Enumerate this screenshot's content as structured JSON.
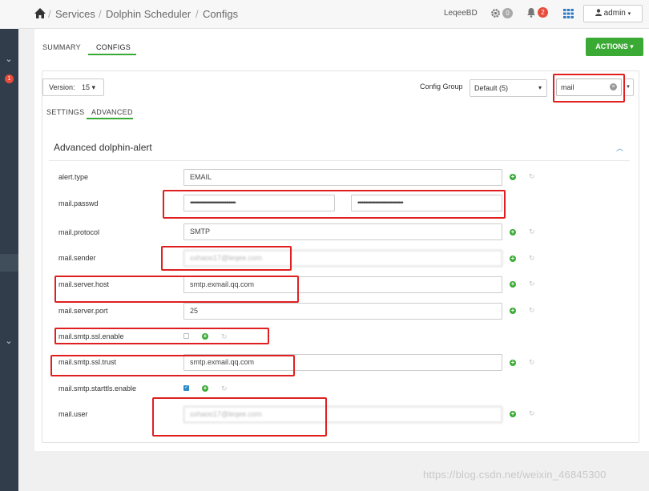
{
  "breadcrumb": {
    "items": [
      "Services",
      "Dolphin Scheduler",
      "Configs"
    ],
    "sep": "/"
  },
  "topbar": {
    "cluster_name": "LeqeeBD",
    "settings_badge": "0",
    "alerts_badge": "2",
    "user_label": "admin",
    "caret": "▾"
  },
  "sidebar": {
    "notification_badge": "1"
  },
  "page_tabs": {
    "summary": "SUMMARY",
    "configs": "CONFIGS"
  },
  "actions_button": "ACTIONS ▾",
  "version": {
    "label": "Version:",
    "value": "15 ▾"
  },
  "config_group": {
    "label": "Config Group",
    "selected": "Default (5)"
  },
  "filter": {
    "value": "mail"
  },
  "config_tabs": {
    "settings": "SETTINGS",
    "advanced": "ADVANCED"
  },
  "section": {
    "title": "Advanced dolphin-alert"
  },
  "properties": [
    {
      "label": "alert.type",
      "value": "EMAIL"
    },
    {
      "label": "mail.passwd",
      "value": "••••••••••••••••••••••••••••••••••",
      "confirm": "••••••••••••••••••••••••••••••••••"
    },
    {
      "label": "mail.protocol",
      "value": "SMTP"
    },
    {
      "label": "mail.sender",
      "value": "xxhaoo17@leqee.com"
    },
    {
      "label": "mail.server.host",
      "value": "smtp.exmail.qq.com"
    },
    {
      "label": "mail.server.port",
      "value": "25"
    },
    {
      "label": "mail.smtp.ssl.enable",
      "checked": false
    },
    {
      "label": "mail.smtp.ssl.trust",
      "value": "smtp.exmail.qq.com"
    },
    {
      "label": "mail.smtp.starttls.enable",
      "checked": true
    },
    {
      "label": "mail.user",
      "value": "xxhaoo17@leqee.com"
    }
  ],
  "watermark": "https://blog.csdn.net/weixin_46845300",
  "colors": {
    "accent_green": "#3aaa35",
    "annotation_red": "#e02020",
    "sidebar_bg": "#313d4a"
  }
}
